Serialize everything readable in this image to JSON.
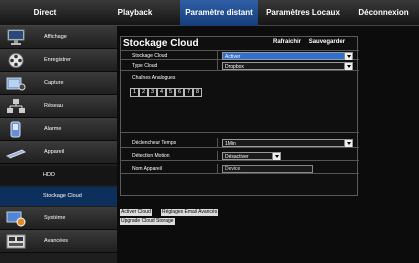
{
  "nav": {
    "tabs": [
      {
        "label": "Direct",
        "active": false
      },
      {
        "label": "Playback",
        "active": false
      },
      {
        "label": "Paramètre distant",
        "active": true
      },
      {
        "label": "Paramètres Locaux",
        "active": false
      },
      {
        "label": "Déconnexion",
        "active": false
      }
    ]
  },
  "sidebar": {
    "items": [
      {
        "label": "Affichage",
        "icon": "monitor-icon"
      },
      {
        "label": "Enregistrer",
        "icon": "film-reel-icon"
      },
      {
        "label": "Capture",
        "icon": "capture-icon"
      },
      {
        "label": "Réseau",
        "icon": "network-icon"
      },
      {
        "label": "Alarme",
        "icon": "alarm-icon"
      },
      {
        "label": "Appareil",
        "icon": "device-icon"
      },
      {
        "label": "Système",
        "icon": "system-icon"
      },
      {
        "label": "Avancées",
        "icon": "advanced-icon"
      }
    ],
    "subitems": [
      {
        "label": "HDD",
        "selected": false
      },
      {
        "label": "Stockage Cloud",
        "selected": true
      }
    ]
  },
  "panel": {
    "title": "Stockage Cloud",
    "refresh_label": "Rafraichir",
    "save_label": "Sauvegarder",
    "rows": {
      "storage": {
        "label": "Stockage Cloud",
        "value": "Activer"
      },
      "type": {
        "label": "Type Cloud",
        "value": "Dropbox"
      },
      "trigger": {
        "label": "Déclencheur Temps",
        "value": "1Min"
      },
      "motion": {
        "label": "Détection Motion",
        "value": "Désactiver"
      },
      "device_name": {
        "label": "Nom Appareil",
        "value": "Device"
      }
    },
    "channels": {
      "title": "Chaînes Analogues",
      "items": [
        "1",
        "2",
        "3",
        "4",
        "5",
        "6",
        "7",
        "8"
      ]
    }
  },
  "links": {
    "enable_cloud": "Activer Cloud",
    "email_settings": "Réglages Email Avancés",
    "upgrade": "Upgrade Cloud Storage"
  },
  "colors": {
    "accent": "#2f6fcf",
    "nav_active": "#173d7a",
    "subitem_selected": "#0d2f5c"
  }
}
